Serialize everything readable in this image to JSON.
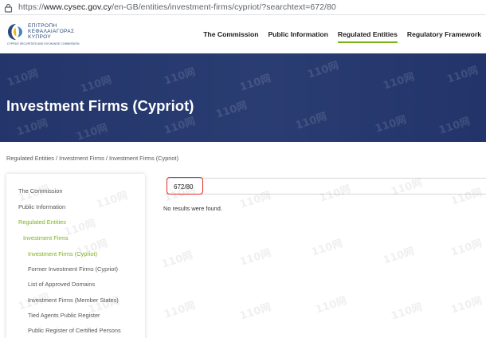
{
  "browser": {
    "url_protocol": "https://",
    "url_host": "www.cysec.gov.cy",
    "url_path": "/en-GB/entities/investment-firms/cypriot/?searchtext=672/80"
  },
  "header": {
    "logo": {
      "line1": "ΕΠΙΤΡΟΠΗ",
      "line2": "ΚΕΦΑΛΑΙΑΓΟΡΑΣ",
      "line3": "ΚΥΠΡΟΥ",
      "small": "CYPRUS SECURITIES AND EXCHANGE COMMISSION"
    },
    "nav": [
      {
        "label": "The Commission",
        "active": false
      },
      {
        "label": "Public Information",
        "active": false
      },
      {
        "label": "Regulated Entities",
        "active": true
      },
      {
        "label": "Regulatory Framework",
        "active": false
      }
    ]
  },
  "hero": {
    "title": "Investment Firms (Cypriot)"
  },
  "breadcrumb": "Regulated Entities / Investment Firms / Investment Firms (Cypriot)",
  "sidebar": {
    "items": [
      {
        "label": "The Commission",
        "level": 0,
        "active": false
      },
      {
        "label": "Public Information",
        "level": 0,
        "active": false
      },
      {
        "label": "Regulated Entities",
        "level": 0,
        "active": true
      },
      {
        "label": "Investment Firms",
        "level": 1,
        "active": true
      },
      {
        "label": "Investment Firms (Cypriot)",
        "level": 2,
        "active": true
      },
      {
        "label": "Former Investment Firms (Cypriot)",
        "level": 2,
        "active": false
      },
      {
        "label": "List of Approved Domains",
        "level": 2,
        "active": false
      },
      {
        "label": "Investment Firms (Member States)",
        "level": 2,
        "active": false
      },
      {
        "label": "Tied Agents Public Register",
        "level": 2,
        "active": false
      },
      {
        "label": "Public Register of Certified Persons",
        "level": 2,
        "active": false
      }
    ]
  },
  "search": {
    "value": "672/80"
  },
  "results": {
    "message": "No results were found."
  },
  "watermark": {
    "text": "110网"
  },
  "colors": {
    "accent": "#7ab317",
    "banner": "#26386d",
    "highlight": "#e0291f"
  }
}
